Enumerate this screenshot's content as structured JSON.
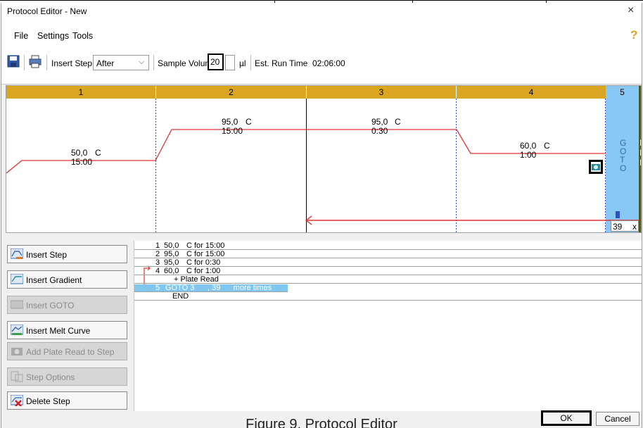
{
  "window": {
    "title": "Protocol Editor - New",
    "close_glyph": "×"
  },
  "menu": {
    "items": [
      "File",
      "Settings",
      "Tools"
    ],
    "help_glyph": "?"
  },
  "toolbar": {
    "insert_step_label": "Insert Step",
    "insert_step_position": "After",
    "sample_volume_label": "Sample Volume",
    "sample_volume_value": "20",
    "volume_unit": "µl",
    "run_time_label": "Est. Run Time",
    "run_time_value": "02:06:00"
  },
  "graph": {
    "steps": [
      {
        "number": "1",
        "temp": "50,0",
        "unit": "C",
        "time": "15:00"
      },
      {
        "number": "2",
        "temp": "95,0",
        "unit": "C",
        "time": "15:00"
      },
      {
        "number": "3",
        "temp": "95,0",
        "unit": "C",
        "time": "0:30"
      },
      {
        "number": "4",
        "temp": "60,0",
        "unit": "C",
        "time": "1:00"
      }
    ],
    "goto": {
      "number": "5",
      "letters": [
        "G",
        "O",
        "T",
        "O"
      ],
      "cycles": "39",
      "x": "x"
    },
    "end_letters": [
      "E",
      "N",
      "D"
    ],
    "line_color": "#e03030",
    "header_color": "#daa520",
    "goto_color": "#88c8f4"
  },
  "side_buttons": [
    {
      "label": "Insert Step",
      "icon": "insert-step-icon",
      "enabled": true
    },
    {
      "label": "Insert Gradient",
      "icon": "insert-gradient-icon",
      "enabled": true
    },
    {
      "label": "Insert GOTO",
      "icon": "insert-goto-icon",
      "enabled": false
    },
    {
      "label": "Insert Melt Curve",
      "icon": "insert-melt-curve-icon",
      "enabled": true
    },
    {
      "label": "Add Plate Read to Step",
      "icon": "camera-icon",
      "enabled": false
    },
    {
      "label": "Step Options",
      "icon": "step-options-icon",
      "enabled": false
    },
    {
      "label": "Delete Step",
      "icon": "delete-step-icon",
      "enabled": true
    }
  ],
  "protocol_list": [
    {
      "num": "1",
      "temp": "50,0",
      "text": "C  for 15:00"
    },
    {
      "num": "2",
      "temp": "95,0",
      "text": "C  for 15:00"
    },
    {
      "num": "3",
      "temp": "95,0",
      "text": "C  for 0:30"
    },
    {
      "num": "4",
      "temp": "60,0",
      "text": "C  for 1:00"
    },
    {
      "num": "",
      "temp": "",
      "text": "+ Plate Read"
    },
    {
      "num": "5",
      "temp": "GOTO 3",
      "text": ", 39      more times"
    },
    {
      "num": "",
      "temp": "",
      "text": "END"
    }
  ],
  "footer": {
    "ok_label": "OK",
    "cancel_label": "Cancel",
    "caption": "Figure 9. Protocol Editor"
  }
}
